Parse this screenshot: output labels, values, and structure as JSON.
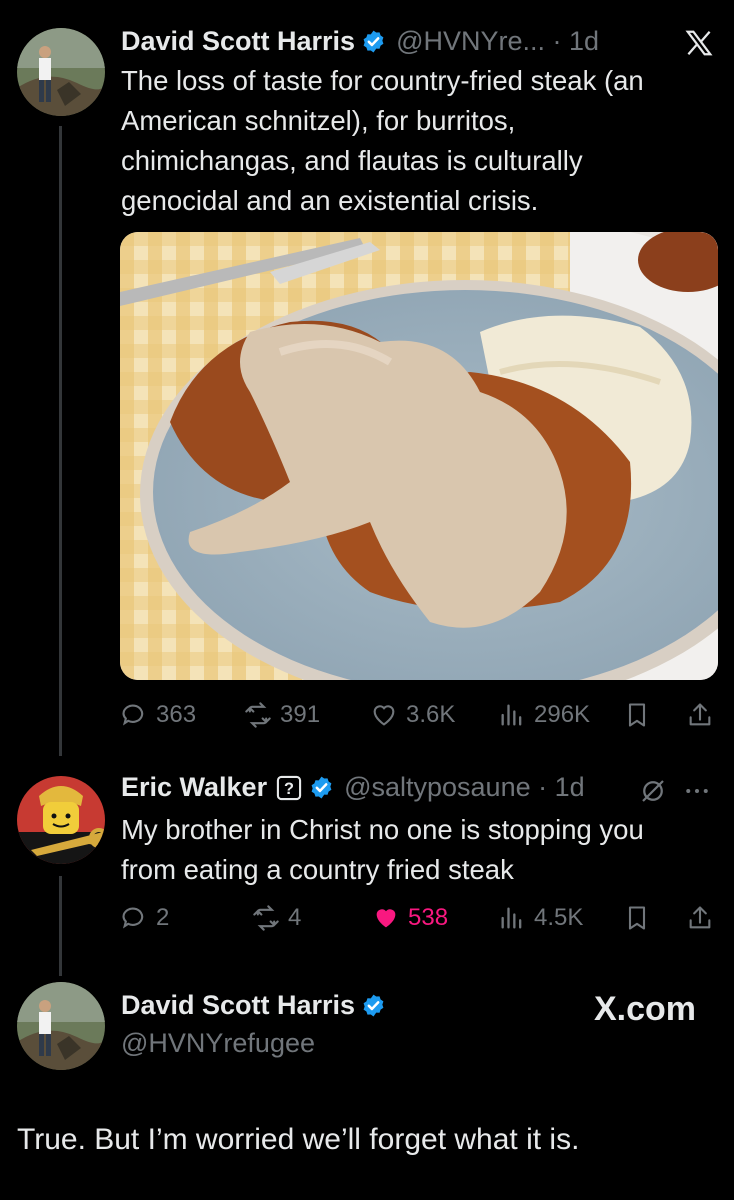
{
  "tweet1": {
    "author_name": "David Scott Harris",
    "handle_time": "@HVNYre... · 1d",
    "text_lines": [
      "The loss of taste for country-fried steak (an",
      "American schnitzel), for burritos,",
      "chimichangas, and flautas is culturally",
      "genocidal and an existential crisis."
    ],
    "stats": {
      "replies": "363",
      "reposts": "391",
      "likes": "3.6K",
      "views": "296K"
    }
  },
  "tweet2": {
    "author_name": "Eric Walker",
    "handle_time": "@saltyposaune · 1d",
    "text_lines": [
      "My brother in Christ no one is stopping you",
      "from eating a country fried steak"
    ],
    "stats": {
      "replies": "2",
      "reposts": "4",
      "likes": "538",
      "views": "4.5K"
    }
  },
  "tweet3": {
    "author_name": "David Scott Harris",
    "handle": "@HVNYrefugee",
    "brand": "X.com",
    "text": "True. But I’m worried we’ll forget what it is."
  },
  "icons": [
    "x-logo-icon",
    "verified-badge-icon",
    "reply-icon",
    "repost-icon",
    "like-icon",
    "views-icon",
    "bookmark-icon",
    "share-icon",
    "grok-icon",
    "more-icon",
    "help-box-icon"
  ],
  "colors": {
    "background": "#000000",
    "text": "#e7e9ea",
    "muted": "#71767b",
    "verified": "#1d9bf0",
    "liked": "#f91880"
  }
}
